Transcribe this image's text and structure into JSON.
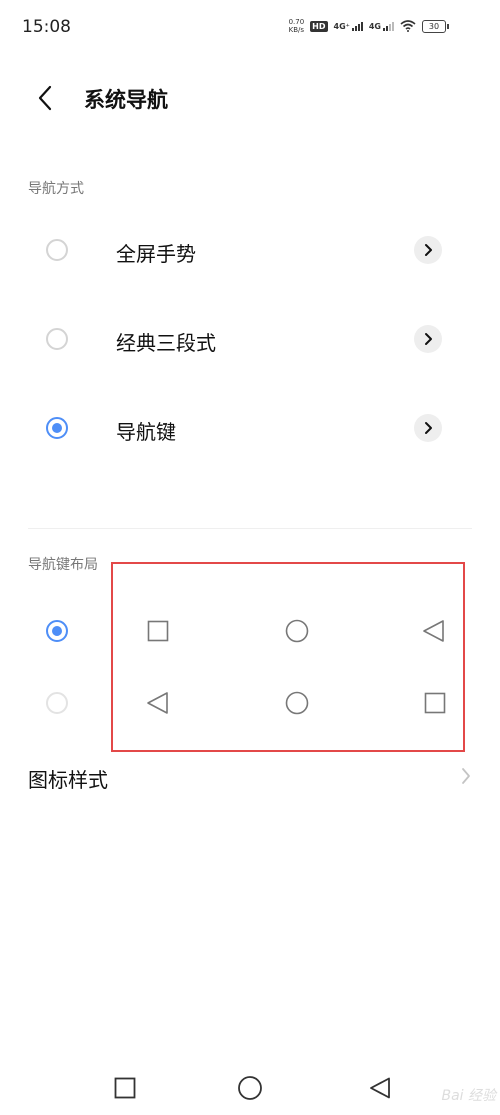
{
  "status_bar": {
    "time": "15:08",
    "speed_value": "0.70",
    "speed_unit": "KB/s",
    "hd_badge": "HD",
    "sim1_network": "4G⁺",
    "sim2_network": "4G",
    "battery": "30"
  },
  "header": {
    "title": "系统导航"
  },
  "navigation_mode": {
    "section_label": "导航方式",
    "options": [
      {
        "label": "全屏手势",
        "selected": false
      },
      {
        "label": "经典三段式",
        "selected": false
      },
      {
        "label": "导航键",
        "selected": true
      }
    ]
  },
  "key_layout": {
    "section_label": "导航键布局",
    "options": [
      {
        "selected": true,
        "keys": [
          "square-icon",
          "circle-icon",
          "back-triangle-icon"
        ]
      },
      {
        "selected": false,
        "keys": [
          "back-triangle-icon",
          "circle-icon",
          "square-icon"
        ]
      }
    ]
  },
  "icon_style": {
    "label": "图标样式"
  },
  "watermark": "Bai 经验",
  "colors": {
    "accent": "#4e8ef7",
    "highlight": "#e34848"
  }
}
